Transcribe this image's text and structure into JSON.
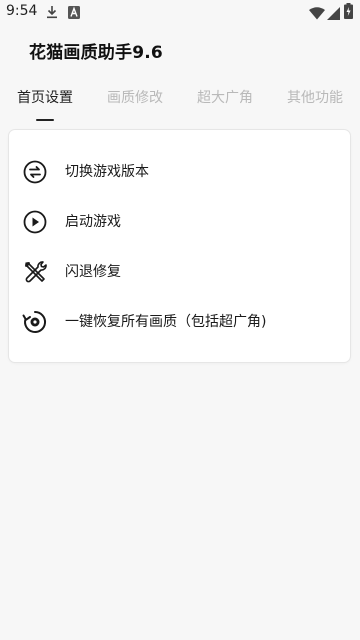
{
  "status_bar": {
    "time": "9:54",
    "icons": [
      "download-icon",
      "a-notification-icon",
      "wifi-icon",
      "signal-icon",
      "battery-charging-icon"
    ]
  },
  "app": {
    "title": "花猫画质助手9.6"
  },
  "tabs": [
    {
      "label": "首页设置",
      "active": true
    },
    {
      "label": "画质修改",
      "active": false
    },
    {
      "label": "超大广角",
      "active": false
    },
    {
      "label": "其他功能",
      "active": false
    }
  ],
  "menu": {
    "items": [
      {
        "label": "切换游戏版本",
        "icon": "swap-circle-icon"
      },
      {
        "label": "启动游戏",
        "icon": "play-circle-icon"
      },
      {
        "label": "闪退修复",
        "icon": "tools-icon"
      },
      {
        "label": "一键恢复所有画质（包括超广角)",
        "icon": "restore-icon"
      }
    ]
  },
  "colors": {
    "background": "#f7f7f7",
    "card": "#ffffff",
    "tab_active": "#222222",
    "tab_inactive": "#b9b9b9"
  }
}
